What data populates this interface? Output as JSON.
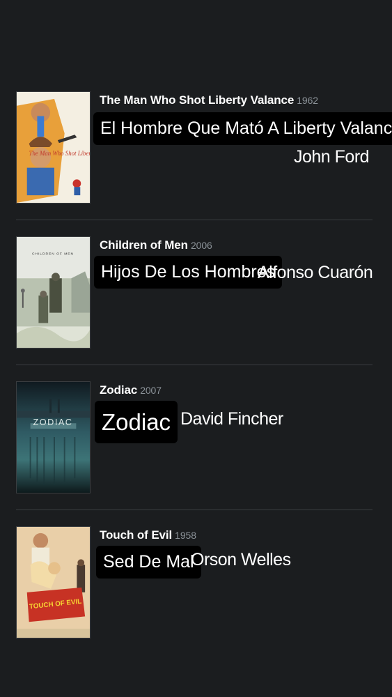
{
  "films": [
    {
      "title": "The Man Who Shot Liberty Valance",
      "year": "1962",
      "spanish_title": "El Hombre Que Mató A Liberty Valance",
      "director": "John Ford",
      "poster_text": "The Man Who Shot Liberty Valance"
    },
    {
      "title": "Children of Men",
      "year": "2006",
      "spanish_title": "Hijos De Los Hombres",
      "director": "Alfonso Cuarón",
      "poster_text": "CHILDREN OF MEN"
    },
    {
      "title": "Zodiac",
      "year": "2007",
      "spanish_title": "Zodiac",
      "director": "David Fincher",
      "poster_text": "ZODIAC"
    },
    {
      "title": "Touch of Evil",
      "year": "1958",
      "spanish_title": "Sed De Mal",
      "director": "Orson Welles",
      "poster_text": "TOUCH OF EVIL"
    }
  ],
  "colors": {
    "background": "#1b1d1f",
    "divider": "#3a3d40",
    "year": "#8c9399",
    "tag_background": "#000000"
  }
}
